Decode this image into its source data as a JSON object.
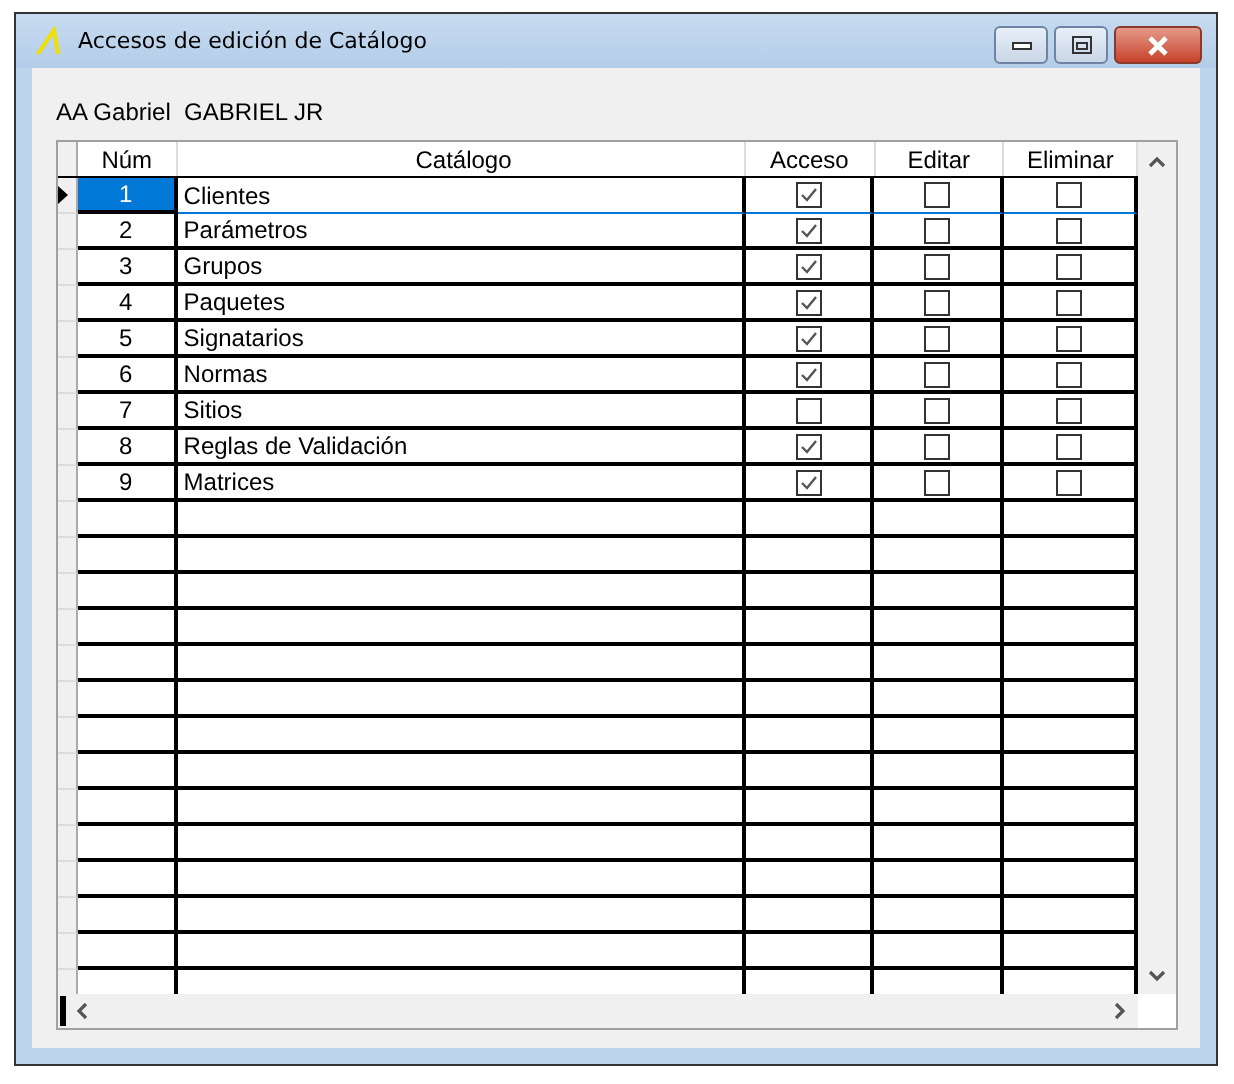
{
  "window": {
    "title": "Accesos de edición de Catálogo"
  },
  "user_label": "AA Gabriel  GABRIEL JR",
  "table": {
    "columns": [
      "Núm",
      "Catálogo",
      "Acceso",
      "Editar",
      "Eliminar"
    ],
    "rows": [
      {
        "num": "1",
        "catalog": "Clientes",
        "acceso": true,
        "editar": false,
        "eliminar": false,
        "selected": true
      },
      {
        "num": "2",
        "catalog": "Parámetros",
        "acceso": true,
        "editar": false,
        "eliminar": false,
        "selected": false
      },
      {
        "num": "3",
        "catalog": "Grupos",
        "acceso": true,
        "editar": false,
        "eliminar": false,
        "selected": false
      },
      {
        "num": "4",
        "catalog": "Paquetes",
        "acceso": true,
        "editar": false,
        "eliminar": false,
        "selected": false
      },
      {
        "num": "5",
        "catalog": "Signatarios",
        "acceso": true,
        "editar": false,
        "eliminar": false,
        "selected": false
      },
      {
        "num": "6",
        "catalog": "Normas",
        "acceso": true,
        "editar": false,
        "eliminar": false,
        "selected": false
      },
      {
        "num": "7",
        "catalog": "Sitios",
        "acceso": false,
        "editar": false,
        "eliminar": false,
        "selected": false
      },
      {
        "num": "8",
        "catalog": "Reglas de Validación",
        "acceso": true,
        "editar": false,
        "eliminar": false,
        "selected": false
      },
      {
        "num": "9",
        "catalog": "Matrices",
        "acceso": true,
        "editar": false,
        "eliminar": false,
        "selected": false
      }
    ]
  }
}
